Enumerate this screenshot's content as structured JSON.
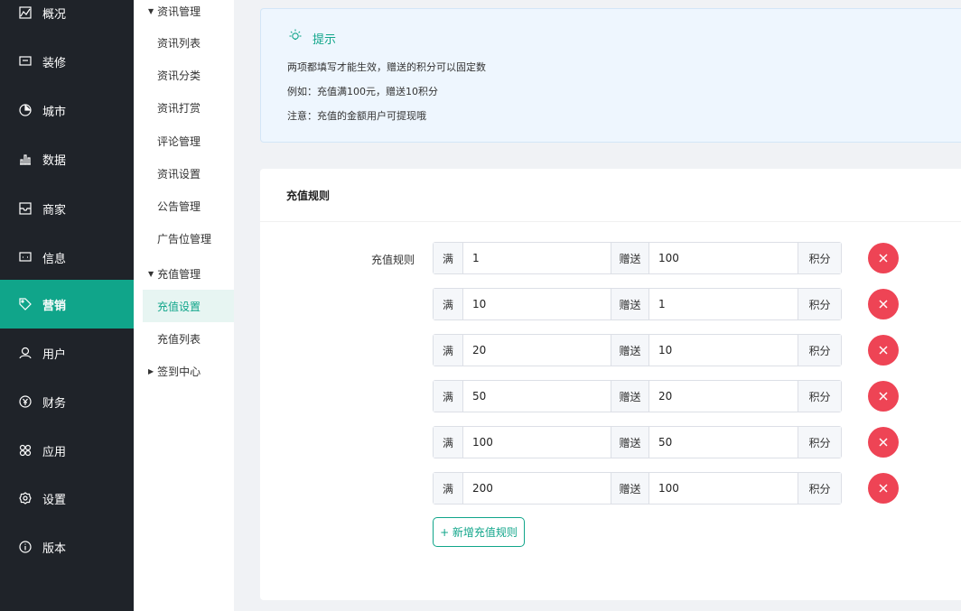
{
  "sidebar": {
    "items": [
      {
        "label": "概况",
        "icon": "chart-area-icon"
      },
      {
        "label": "装修",
        "icon": "message-square-icon"
      },
      {
        "label": "城市",
        "icon": "pie-chart-icon"
      },
      {
        "label": "数据",
        "icon": "bar-chart-icon"
      },
      {
        "label": "商家",
        "icon": "inbox-icon"
      },
      {
        "label": "信息",
        "icon": "message-icon"
      },
      {
        "label": "营销",
        "icon": "tag-icon",
        "active": true
      },
      {
        "label": "用户",
        "icon": "user-icon"
      },
      {
        "label": "财务",
        "icon": "yen-icon"
      },
      {
        "label": "应用",
        "icon": "apps-icon"
      },
      {
        "label": "设置",
        "icon": "gear-icon"
      },
      {
        "label": "版本",
        "icon": "info-icon"
      }
    ],
    "active_color": "#10a58a"
  },
  "submenu": {
    "group1": "资讯管理",
    "group1_items": [
      "资讯列表",
      "资讯分类",
      "资讯打赏",
      "评论管理",
      "资讯设置",
      "公告管理",
      "广告位管理"
    ],
    "group2": "充值管理",
    "group2_items": [
      "充值设置",
      "充值列表"
    ],
    "group3": "签到中心"
  },
  "tip": {
    "title": "提示",
    "lines": [
      "两项都填写才能生效，赠送的积分可以固定数",
      "例如：充值满100元，赠送10积分",
      "注意：充值的金额用户可提现哦"
    ]
  },
  "card": {
    "title": "充值规则",
    "label": "充值规则",
    "prefix": "满",
    "middle": "赠送",
    "suffix": "积分",
    "rules": [
      {
        "full": "1",
        "give": "100"
      },
      {
        "full": "10",
        "give": "1"
      },
      {
        "full": "20",
        "give": "10"
      },
      {
        "full": "50",
        "give": "20"
      },
      {
        "full": "100",
        "give": "50"
      },
      {
        "full": "200",
        "give": "100"
      }
    ],
    "add_label": "+ 新增充值规则",
    "delete_color": "#ee4455"
  }
}
